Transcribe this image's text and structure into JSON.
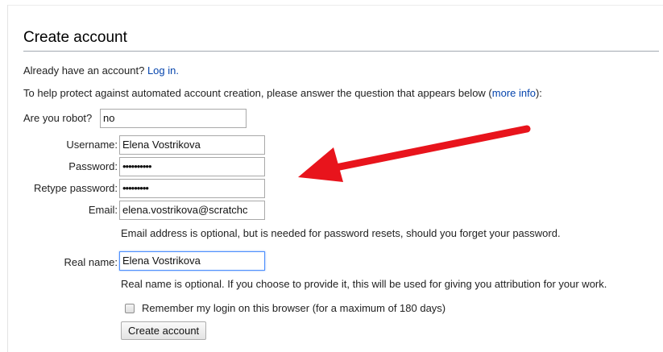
{
  "title": "Create account",
  "login_prompt": {
    "text": "Already have an account?",
    "link": "Log in."
  },
  "captcha_note": {
    "text": "To help protect against automated account creation, please answer the question that appears below (",
    "link": "more info",
    "suffix": "):"
  },
  "robot_question": {
    "label": "Are you robot?",
    "value": "no"
  },
  "fields": {
    "username": {
      "label": "Username:",
      "value": "Elena Vostrikova"
    },
    "password": {
      "label": "Password:",
      "value": "••••••••••"
    },
    "retype_password": {
      "label": "Retype password:",
      "value": "•••••••••"
    },
    "email": {
      "label": "Email:",
      "value": "elena.vostrikova@scratchc"
    },
    "real_name": {
      "label": "Real name:",
      "value": "Elena Vostrikova"
    }
  },
  "help": {
    "email": "Email address is optional, but is needed for password resets, should you forget your password.",
    "real_name": "Real name is optional. If you choose to provide it, this will be used for giving you attribution for your work."
  },
  "remember": {
    "label": "Remember my login on this browser (for a maximum of 180 days)",
    "checked": false
  },
  "submit_label": "Create account",
  "colors": {
    "link": "#0645ad",
    "arrow": "#e8141c",
    "focus": "#4d90fe"
  }
}
